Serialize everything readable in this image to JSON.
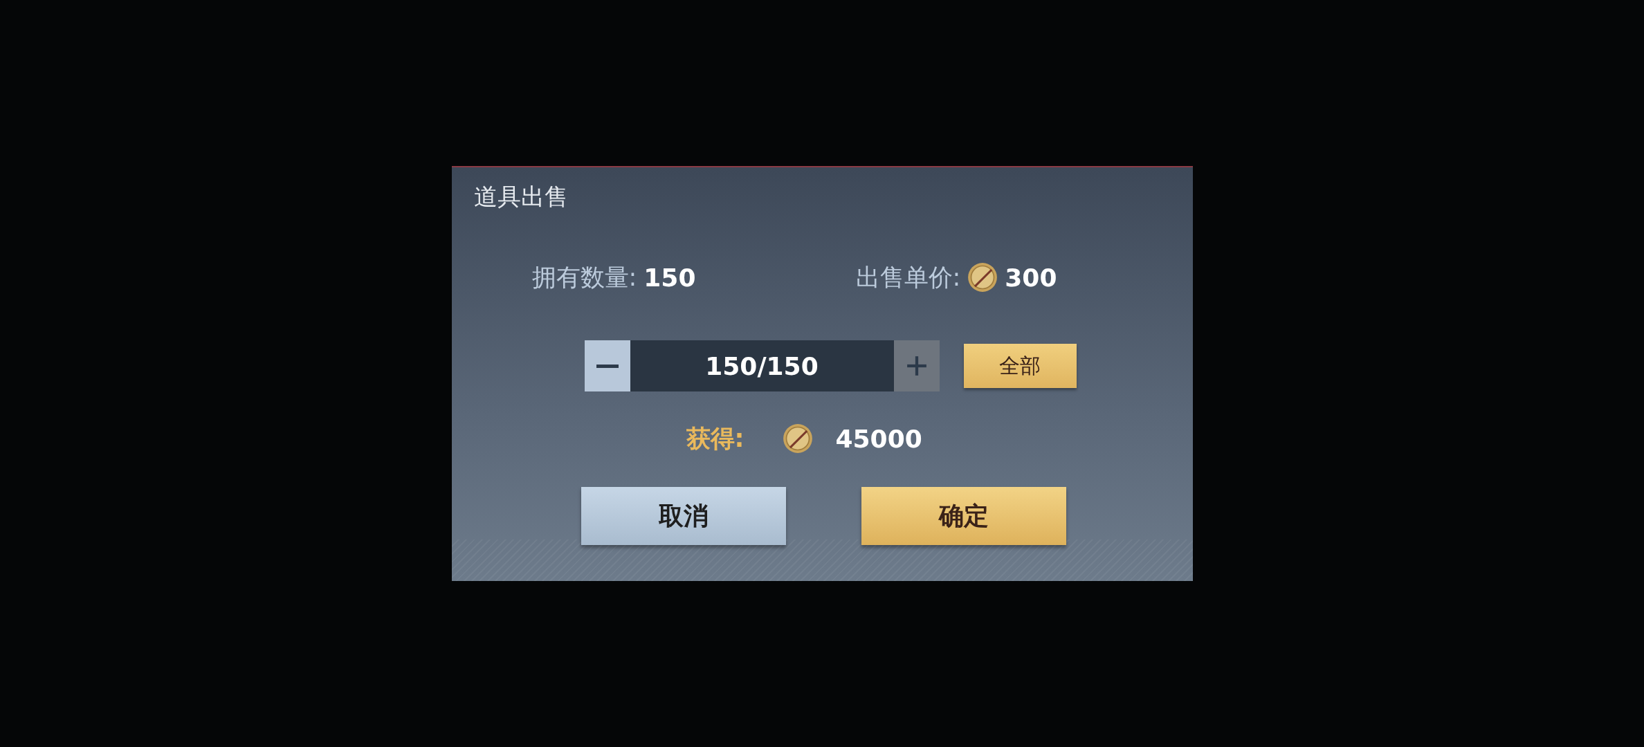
{
  "dialog": {
    "title": "道具出售",
    "owned": {
      "label": "拥有数量:",
      "value": "150"
    },
    "unit_price": {
      "label": "出售单价:",
      "value": "300"
    },
    "stepper": {
      "value": "150/150",
      "minus_disabled": false,
      "plus_disabled": true
    },
    "all_button": "全部",
    "earn": {
      "label": "获得:",
      "value": "45000"
    },
    "buttons": [
      {
        "label": "取消",
        "kind": "secondary"
      },
      {
        "label": "确定",
        "kind": "primary"
      }
    ]
  }
}
